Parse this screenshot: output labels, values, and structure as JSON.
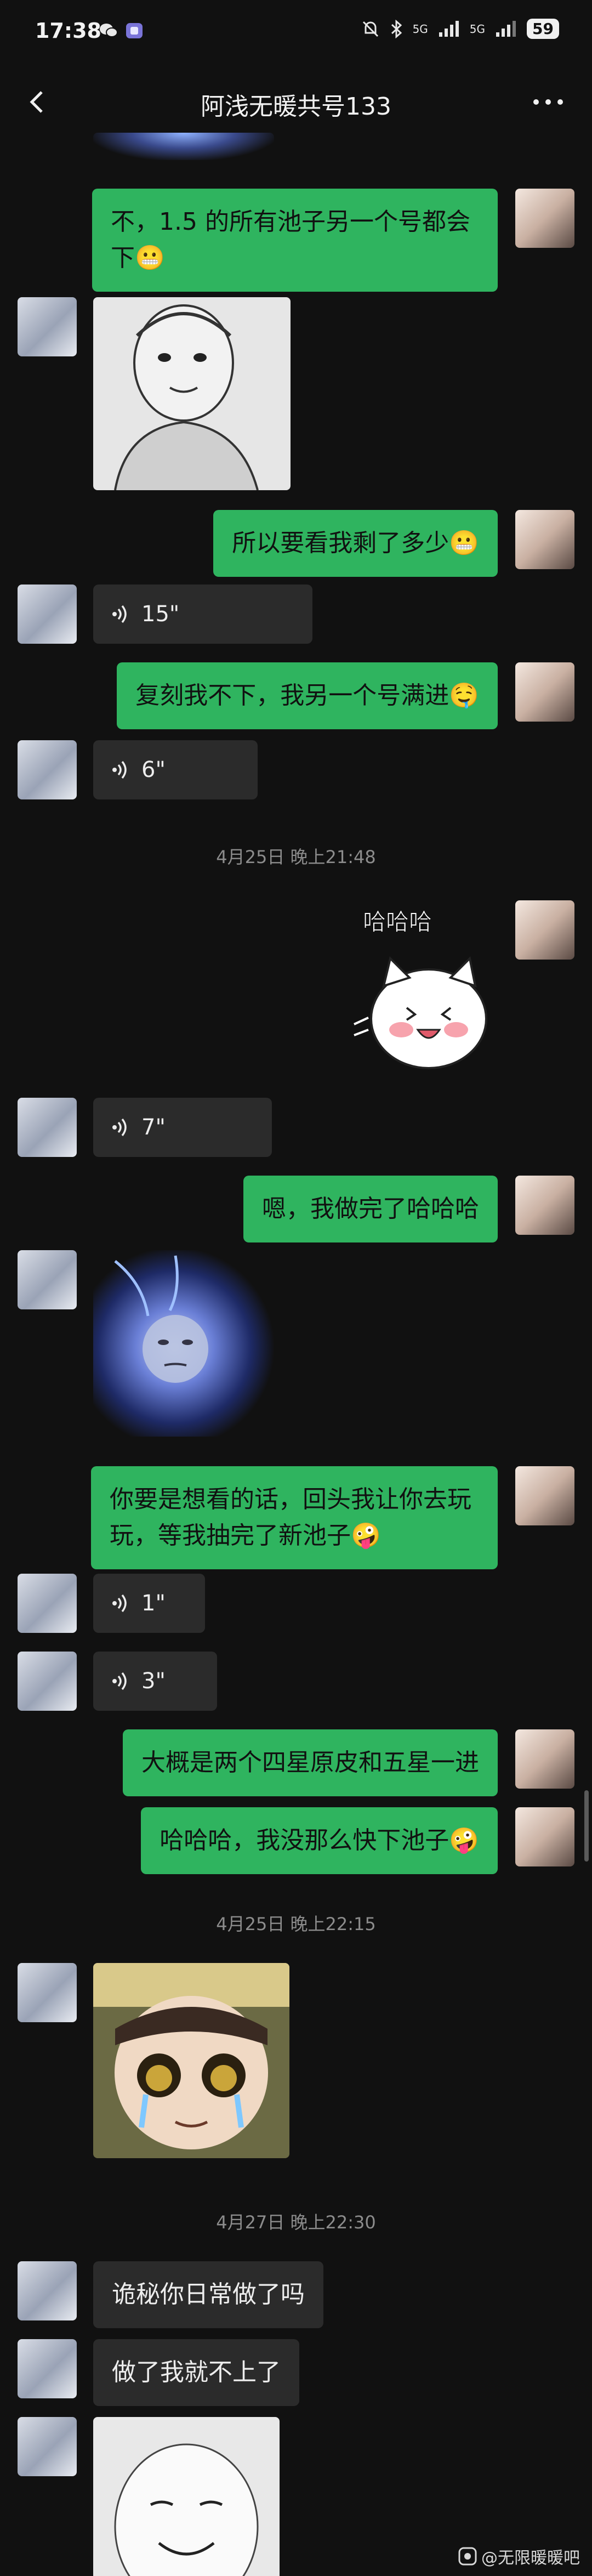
{
  "status_bar": {
    "time": "17:38",
    "battery": "59",
    "network": "5G"
  },
  "header": {
    "title": "阿浅无暖共号133"
  },
  "messages": {
    "m1": "不，1.5 的所有池子另一个号都会下😬",
    "m2": "所以要看我剩了多少😬",
    "v1": "15\"",
    "m3": "复刻我不下，我另一个号满进🤤",
    "v2": "6\"",
    "t1": "4月25日 晚上21:48",
    "sticker_text": "哈哈哈",
    "v3": "7\"",
    "m4": "嗯，我做完了哈哈哈",
    "m5_l1": "你要是想看的话，回头我让你去玩",
    "m5_l2": "玩，等我抽完了新池子🤪",
    "v4": "1\"",
    "v5": "3\"",
    "m6": "大概是两个四星原皮和五星一进",
    "m7": "哈哈哈，我没那么快下池子🤪",
    "t2": "4月25日 晚上22:15",
    "t3": "4月27日 晚上22:30",
    "m8": "诡秘你日常做了吗",
    "m9": "做了我就不上了"
  },
  "watermark": "@无限暖暖吧",
  "colors": {
    "background": "#111111",
    "my_bubble": "#2fb45f",
    "other_bubble": "#2b2b2b",
    "timestamp": "#8c8c8c"
  },
  "icons": [
    "back-arrow-icon",
    "more-icon",
    "voice-wave-icon",
    "wechat-icon",
    "mute-icon",
    "bluetooth-icon",
    "signal-icon"
  ]
}
